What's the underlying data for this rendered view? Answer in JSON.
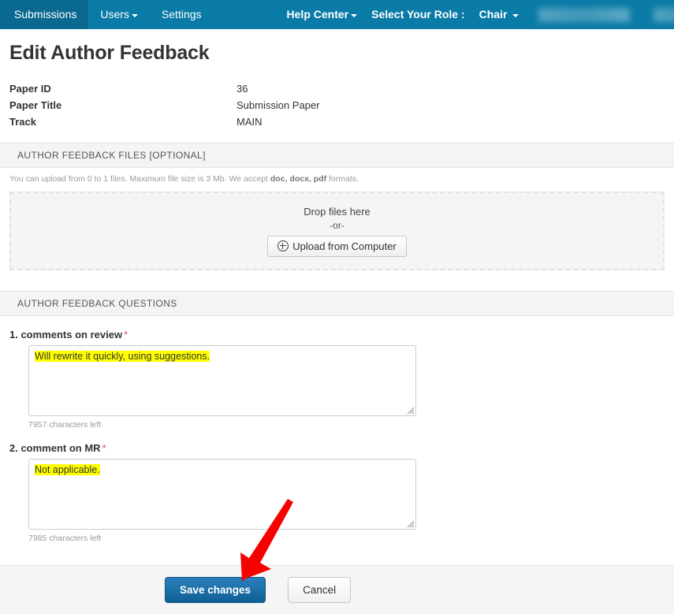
{
  "navbar": {
    "background_color": "#0a7ba6",
    "left_items": [
      {
        "label": "Submissions",
        "has_caret": false
      },
      {
        "label": "Users",
        "has_caret": true
      },
      {
        "label": "Settings",
        "has_caret": false
      }
    ],
    "right_items": [
      {
        "label": "Help Center",
        "has_caret": true
      },
      {
        "label": "Select Your Role :",
        "has_caret": false
      },
      {
        "label": "Chair",
        "has_caret": true
      }
    ],
    "redacted_blocks": 2
  },
  "page": {
    "title": "Edit Author Feedback"
  },
  "paper_info": {
    "rows": [
      {
        "label": "Paper ID",
        "value": "36"
      },
      {
        "label": "Paper Title",
        "value": "Submission Paper"
      },
      {
        "label": "Track",
        "value": "MAIN"
      }
    ]
  },
  "files_section": {
    "header": "AUTHOR FEEDBACK FILES [OPTIONAL]",
    "hint_prefix": "You can upload from 0 to 1 files. Maximum file size is 3 Mb. We accept ",
    "hint_formats": "doc, docx, pdf",
    "hint_suffix": " formats.",
    "dropzone": {
      "drop_text": "Drop files here",
      "or_text": "-or-",
      "upload_button_label": "Upload from Computer",
      "upload_button_icon": "plus-circle-icon"
    }
  },
  "questions_section": {
    "header": "AUTHOR FEEDBACK QUESTIONS",
    "required_marker": "*",
    "items": [
      {
        "label": "1. comments on review",
        "answer": "Will rewrite it quickly, using suggestions.",
        "chars_left": "7957 characters left",
        "highlight_color": "#ffff00"
      },
      {
        "label": "2. comment on MR",
        "answer": "Not applicable.",
        "chars_left": "7985 characters left",
        "highlight_color": "#ffff00"
      }
    ]
  },
  "footer": {
    "save_label": "Save changes",
    "cancel_label": "Cancel",
    "save_color": "#1b6fa8"
  },
  "annotation": {
    "type": "arrow",
    "color": "#f70000",
    "points_to": "save-changes-button"
  }
}
